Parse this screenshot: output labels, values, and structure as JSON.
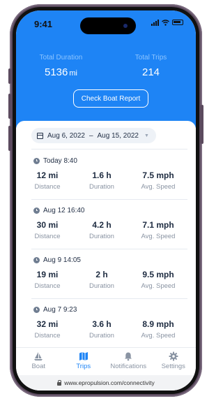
{
  "status_bar": {
    "time": "9:41"
  },
  "summary": {
    "total_duration_label": "Total Duration",
    "total_duration_value": "5136",
    "total_duration_unit": "mi",
    "total_trips_label": "Total Trips",
    "total_trips_value": "214"
  },
  "report_button_label": "Check Boat Report",
  "date_range": {
    "start": "Aug 6, 2022",
    "separator": "–",
    "end": "Aug 15, 2022"
  },
  "trips": [
    {
      "time": "Today 8:40",
      "distance": "12 mi",
      "duration": "1.6 h",
      "speed": "7.5 mph"
    },
    {
      "time": "Aug 12 16:40",
      "distance": "30 mi",
      "duration": "4.2 h",
      "speed": "7.1 mph"
    },
    {
      "time": "Aug 9 14:05",
      "distance": "19 mi",
      "duration": "2 h",
      "speed": "9.5 mph"
    },
    {
      "time": "Aug 7 9:23",
      "distance": "32 mi",
      "duration": "3.6 h",
      "speed": "8.9 mph"
    }
  ],
  "metric_labels": {
    "distance": "Distance",
    "duration": "Duration",
    "speed": "Avg. Speed"
  },
  "tabs": [
    {
      "label": "Boat",
      "icon": "sailboat-icon"
    },
    {
      "label": "Trips",
      "icon": "map-icon"
    },
    {
      "label": "Notifications",
      "icon": "bell-icon"
    },
    {
      "label": "Settings",
      "icon": "gear-icon"
    }
  ],
  "active_tab": "Trips",
  "url": "www.epropulsion.com/connectivity",
  "colors": {
    "accent": "#1e84f5",
    "phone_frame": "#5b4a5e"
  }
}
